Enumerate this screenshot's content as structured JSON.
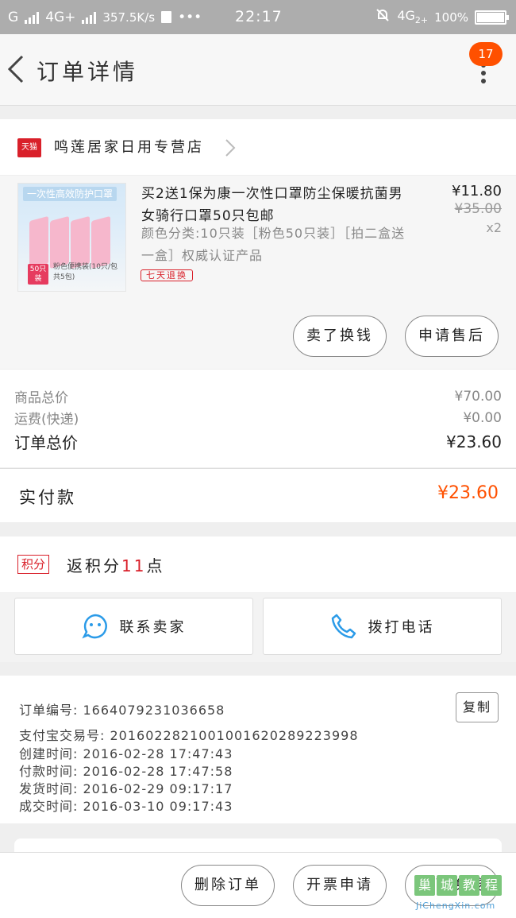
{
  "status_bar": {
    "carrier1": "G",
    "carrier2": "4G+",
    "speed": "357.5K/s",
    "dots": "•••",
    "time": "22:17",
    "net": "4G",
    "net_sub": "2+",
    "battery": "100%",
    "battery_level": 1.0
  },
  "header": {
    "title": "订单详情",
    "badge": "17"
  },
  "store": {
    "tag": "天猫",
    "name": "鸣莲居家日用专营店"
  },
  "product": {
    "title": "买2送1保为康一次性口罩防尘保暖抗菌男女骑行口罩50只包邮",
    "spec": "颜色分类:10只装［粉色50只装］［拍二盒送一盒］权威认证产品",
    "tag": "七天退换",
    "price": "¥11.80",
    "old_price": "¥35.00",
    "qty": "x2",
    "thumb": {
      "banner": "一次性高效防护口罩",
      "pack": "50只装",
      "caption": "粉色便携装(10只/包 共5包)"
    },
    "buttons": {
      "sell": "卖了换钱",
      "aftersale": "申请售后"
    }
  },
  "totals": {
    "goods_label": "商品总价",
    "goods_value": "¥70.00",
    "ship_label": "运费(快递)",
    "ship_value": "¥0.00",
    "order_label": "订单总价",
    "order_value": "¥23.60"
  },
  "paid": {
    "label": "实付款",
    "amount": "¥23.60"
  },
  "points": {
    "tag": "积分",
    "prefix": "返积分",
    "count": "11",
    "suffix": "点"
  },
  "contact": {
    "seller": "联系卖家",
    "call": "拨打电话"
  },
  "order_info": {
    "number": "订单编号: 1664079231036658",
    "copy": "复制",
    "alipay": "支付宝交易号: 2016022821001001620289223998",
    "created": "创建时间: 2016-02-28 17:47:43",
    "paid": "付款时间: 2016-02-28 17:47:58",
    "shipped": "发货时间: 2016-02-29 09:17:17",
    "completed": "成交时间: 2016-03-10 09:17:43"
  },
  "bottom": {
    "delete": "删除订单",
    "invoice": "开票申请",
    "sell": "卖了换钱"
  },
  "watermark": {
    "logo": "巢·城教程",
    "url": "JiChengXin.com"
  },
  "colors": {
    "accent": "#ff5000",
    "tmall_red": "#d9202a",
    "icon_blue": "#2b9be8"
  }
}
